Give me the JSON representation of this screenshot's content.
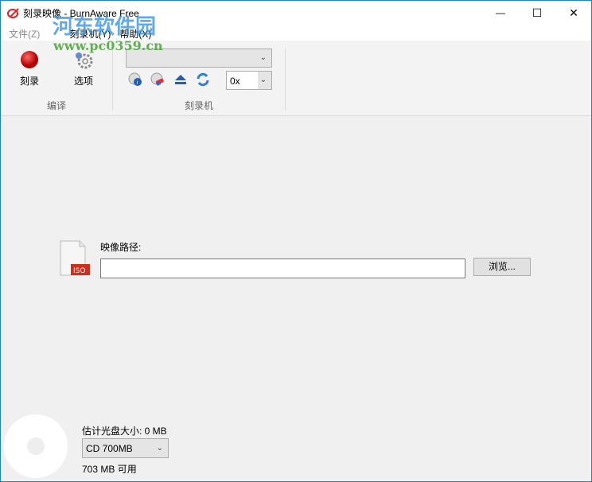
{
  "window": {
    "title": "刻录映像 - BurnAware Free",
    "minimize": "—",
    "maximize": "☐",
    "close": "✕"
  },
  "watermark": {
    "line1": "河东软件园",
    "line2": "www.pc0359.cn"
  },
  "menu": [
    {
      "label": "文件(Z)"
    },
    {
      "label": "刻录机(Y)"
    },
    {
      "label": "帮助(X)"
    }
  ],
  "ribbon": {
    "burn_label": "刻录",
    "options_label": "选项",
    "group_compile": "编译",
    "drive_value": "",
    "speed_value": "0x",
    "group_burner": "刻录机"
  },
  "main": {
    "path_label": "映像路径:",
    "path_value": "",
    "browse_label": "浏览...",
    "iso_badge": "ISO"
  },
  "footer": {
    "est_size": "估计光盘大小: 0 MB",
    "disc_type": "CD 700MB",
    "available": "703 MB 可用"
  }
}
